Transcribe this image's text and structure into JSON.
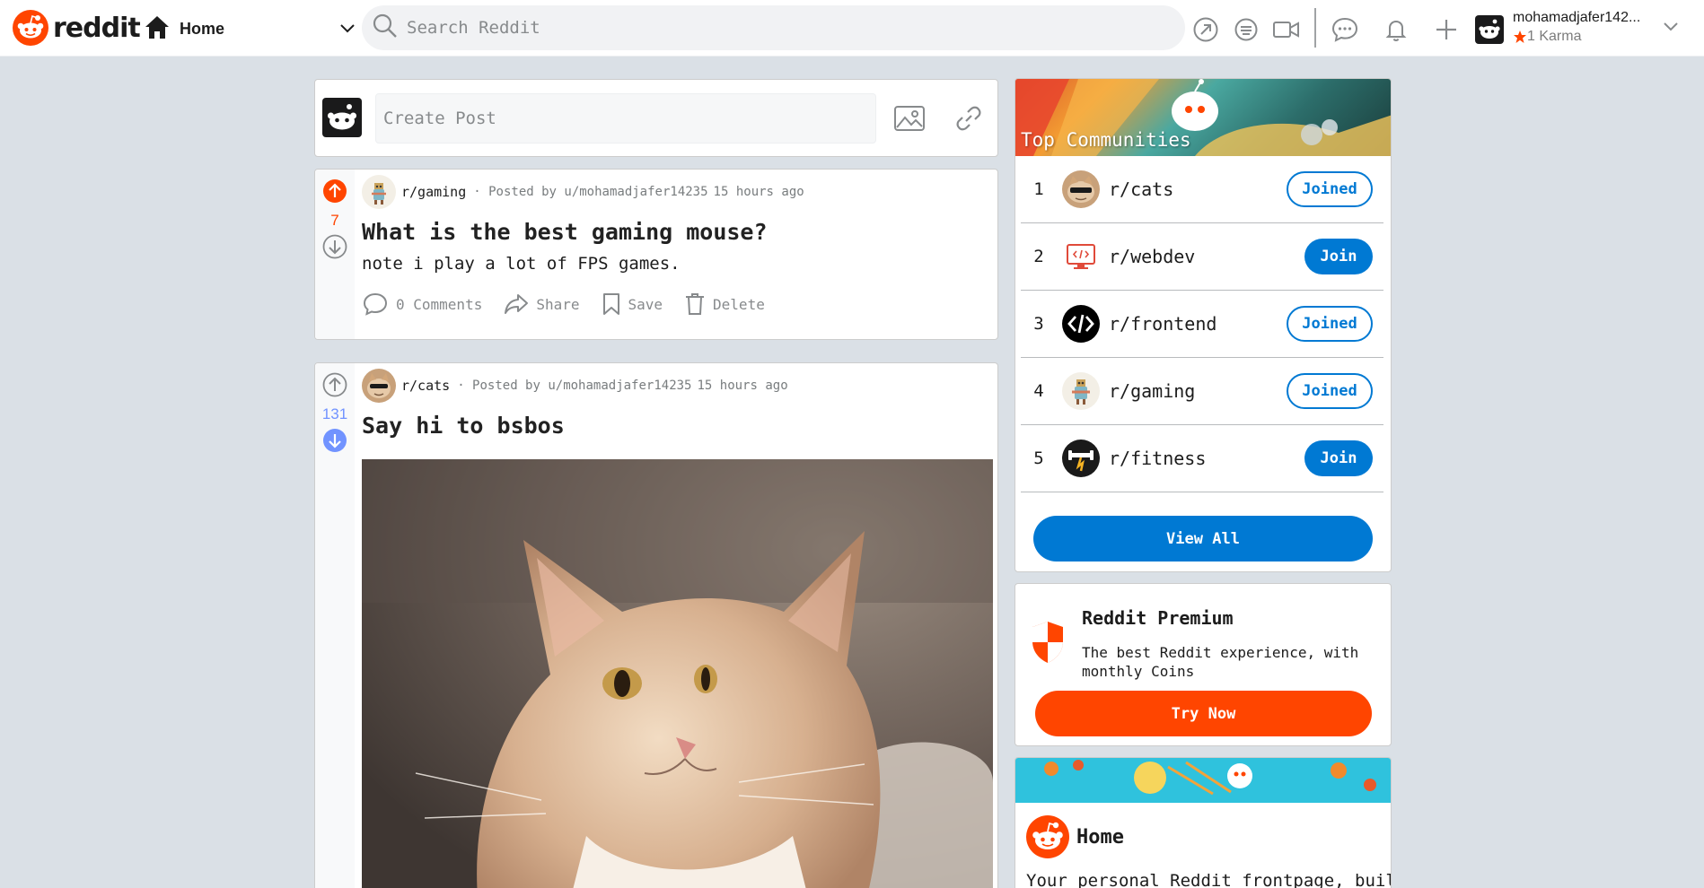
{
  "header": {
    "logo_text": "reddit",
    "home_label": "Home",
    "search_placeholder": "Search Reddit",
    "username": "mohamadjafer142...",
    "karma": "1 Karma"
  },
  "create_post": {
    "placeholder": "Create Post"
  },
  "posts": [
    {
      "subreddit": "r/gaming",
      "posted_by": "· Posted by u/mohamadjafer14235",
      "time": "15 hours ago",
      "votes": "7",
      "vote_state": "upvoted",
      "title": "What is the best gaming mouse?",
      "body": "note i play a lot of FPS games.",
      "actions": {
        "comments": "0 Comments",
        "share": "Share",
        "save": "Save",
        "delete": "Delete"
      }
    },
    {
      "subreddit": "r/cats",
      "posted_by": "· Posted by u/mohamadjafer14235",
      "time": "15 hours ago",
      "votes": "131",
      "vote_state": "downvoted",
      "title": "Say hi to bsbos"
    }
  ],
  "top_communities": {
    "title": "Top Communities",
    "items": [
      {
        "rank": "1",
        "name": "r/cats",
        "button": "Joined"
      },
      {
        "rank": "2",
        "name": "r/webdev",
        "button": "Join"
      },
      {
        "rank": "3",
        "name": "r/frontend",
        "button": "Joined"
      },
      {
        "rank": "4",
        "name": "r/gaming",
        "button": "Joined"
      },
      {
        "rank": "5",
        "name": "r/fitness",
        "button": "Join"
      }
    ],
    "view_all": "View All"
  },
  "premium": {
    "title": "Reddit Premium",
    "description": "The best Reddit experience, with monthly Coins",
    "button": "Try Now"
  },
  "home_card": {
    "title": "Home",
    "description": "Your personal Reddit frontpage, built"
  },
  "colors": {
    "brand": "#ff4500",
    "accent": "#0079d3",
    "upvote": "#ff4500",
    "downvote": "#7193ff",
    "background": "#dae0e6"
  }
}
